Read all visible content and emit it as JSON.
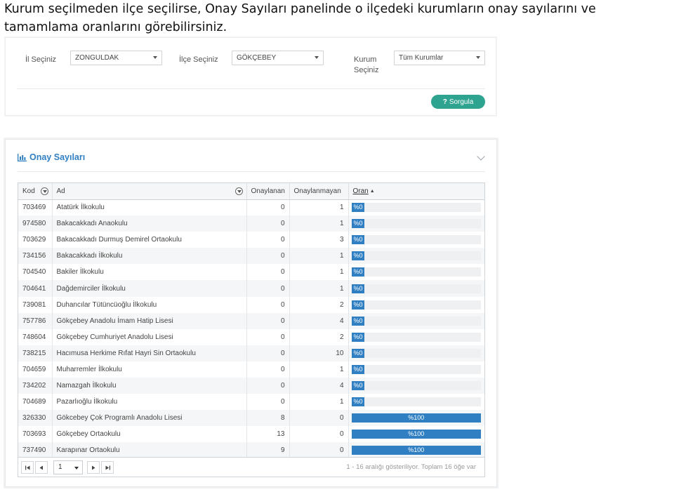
{
  "caption": "Kurum seçilmeden ilçe seçilirse, Onay Sayıları panelinde o ilçedeki kurumların onay sayılarını ve tamamlama oranlarını görebilirsiniz.",
  "filters": {
    "il_label": "İl Seçiniz",
    "il_value": "ZONGULDAK",
    "ilce_label": "İlçe Seçiniz",
    "ilce_value": "GÖKÇEBEY",
    "kurum_label_1": "Kurum",
    "kurum_label_2": "Seçiniz",
    "kurum_value": "Tüm Kurumlar",
    "sorgula_label": "Sorgula",
    "sorgula_icon": "?"
  },
  "panel": {
    "title": "Onay Sayıları",
    "title_icon": "bar-chart-icon",
    "accent_color": "#2f7fc2",
    "button_color": "#2ea38f"
  },
  "table": {
    "columns": [
      "Kod",
      "Ad",
      "Onaylanan",
      "Onaylanmayan",
      "Oran"
    ],
    "sort_indicator": "▲",
    "rows": [
      {
        "kod": "703469",
        "ad": "Atatürk İlkokulu",
        "onaylanan": "0",
        "onaylanmayan": "1",
        "oran": "%0",
        "ratio": 0
      },
      {
        "kod": "974580",
        "ad": "Bakacakkadı Anaokulu",
        "onaylanan": "0",
        "onaylanmayan": "1",
        "oran": "%0",
        "ratio": 0
      },
      {
        "kod": "703629",
        "ad": "Bakacakkadı Durmuş Demirel Ortaokulu",
        "onaylanan": "0",
        "onaylanmayan": "3",
        "oran": "%0",
        "ratio": 0
      },
      {
        "kod": "734156",
        "ad": "Bakacakkadı İlkokulu",
        "onaylanan": "0",
        "onaylanmayan": "1",
        "oran": "%0",
        "ratio": 0
      },
      {
        "kod": "704540",
        "ad": "Bakiler İlkokulu",
        "onaylanan": "0",
        "onaylanmayan": "1",
        "oran": "%0",
        "ratio": 0
      },
      {
        "kod": "704641",
        "ad": "Dağdemirciler İlkokulu",
        "onaylanan": "0",
        "onaylanmayan": "1",
        "oran": "%0",
        "ratio": 0
      },
      {
        "kod": "739081",
        "ad": "Duhancılar Tütüncüoğlu İlkokulu",
        "onaylanan": "0",
        "onaylanmayan": "2",
        "oran": "%0",
        "ratio": 0
      },
      {
        "kod": "757786",
        "ad": "Gökçebey Anadolu İmam Hatip Lisesi",
        "onaylanan": "0",
        "onaylanmayan": "4",
        "oran": "%0",
        "ratio": 0
      },
      {
        "kod": "748604",
        "ad": "Gökçebey Cumhuriyet Anadolu Lisesi",
        "onaylanan": "0",
        "onaylanmayan": "2",
        "oran": "%0",
        "ratio": 0
      },
      {
        "kod": "738215",
        "ad": "Hacımusa Herkime Rıfat Hayri Sin Ortaokulu",
        "onaylanan": "0",
        "onaylanmayan": "10",
        "oran": "%0",
        "ratio": 0
      },
      {
        "kod": "704659",
        "ad": "Muharremler İlkokulu",
        "onaylanan": "0",
        "onaylanmayan": "1",
        "oran": "%0",
        "ratio": 0
      },
      {
        "kod": "734202",
        "ad": "Namazgah İlkokulu",
        "onaylanan": "0",
        "onaylanmayan": "4",
        "oran": "%0",
        "ratio": 0
      },
      {
        "kod": "704689",
        "ad": "Pazarlıoğlu İlkokulu",
        "onaylanan": "0",
        "onaylanmayan": "1",
        "oran": "%0",
        "ratio": 0
      },
      {
        "kod": "326330",
        "ad": "Gökcebey Çok Programlı Anadolu Lisesi",
        "onaylanan": "8",
        "onaylanmayan": "0",
        "oran": "%100",
        "ratio": 1
      },
      {
        "kod": "703693",
        "ad": "Gökçebey Ortaokulu",
        "onaylanan": "13",
        "onaylanmayan": "0",
        "oran": "%100",
        "ratio": 1
      },
      {
        "kod": "737490",
        "ad": "Karapınar Ortaokulu",
        "onaylanan": "9",
        "onaylanmayan": "0",
        "oran": "%100",
        "ratio": 1
      }
    ]
  },
  "pager": {
    "page": "1",
    "info": "1 - 16 aralığı gösteriliyor. Toplam 16 öğe var",
    "first_icon": "first-page-icon",
    "prev_icon": "prev-page-icon",
    "next_icon": "next-page-icon",
    "last_icon": "last-page-icon"
  }
}
